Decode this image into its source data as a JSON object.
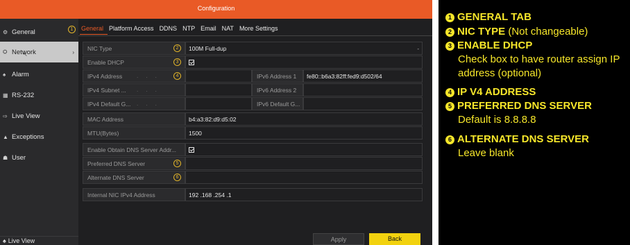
{
  "window": {
    "title": "Configuration"
  },
  "sidebar": {
    "items": [
      {
        "label": "General",
        "icon": "gear-icon",
        "glyph": "⚙"
      },
      {
        "label": "Network",
        "icon": "network-icon",
        "glyph": "⛭",
        "active": true,
        "arrow": "›"
      },
      {
        "label": "Alarm",
        "icon": "alarm-icon",
        "glyph": "♠"
      },
      {
        "label": "RS-232",
        "icon": "rs232-icon",
        "glyph": "▦"
      },
      {
        "label": "Live View",
        "icon": "live-view-icon",
        "glyph": "⇨"
      },
      {
        "label": "Exceptions",
        "icon": "warning-icon",
        "glyph": "▲"
      },
      {
        "label": "User",
        "icon": "user-icon",
        "glyph": "☗"
      }
    ],
    "bottom": {
      "label": "Live View",
      "glyph": "♠"
    }
  },
  "tabs": [
    {
      "label": "General",
      "active": true
    },
    {
      "label": "Platform Access"
    },
    {
      "label": "DDNS"
    },
    {
      "label": "NTP"
    },
    {
      "label": "Email"
    },
    {
      "label": "NAT"
    },
    {
      "label": "More Settings"
    }
  ],
  "markers": [
    "1",
    "2",
    "3",
    "4",
    "5",
    "6"
  ],
  "form": {
    "nic_type": {
      "label": "NIC Type",
      "value": "100M Full-dup"
    },
    "enable_dhcp": {
      "label": "Enable DHCP",
      "checked": true
    },
    "ipv4_address": {
      "label": "IPv4 Address"
    },
    "ipv4_subnet": {
      "label": "IPv4 Subnet ..."
    },
    "ipv4_gateway": {
      "label": "IPv4 Default G..."
    },
    "ipv6_address_1": {
      "label": "IPv6 Address 1",
      "value": "fe80::b6a3:82ff:fed9:d502/64"
    },
    "ipv6_address_2": {
      "label": "IPv6 Address 2"
    },
    "ipv6_gateway": {
      "label": "IPv6 Default G..."
    },
    "mac_address": {
      "label": "MAC Address",
      "value": "b4:a3:82:d9:d5:02"
    },
    "mtu": {
      "label": "MTU(Bytes)",
      "value": "1500"
    },
    "obtain_dns": {
      "label": "Enable Obtain DNS Server Addr...",
      "checked": true
    },
    "preferred_dns": {
      "label": "Preferred DNS Server"
    },
    "alternate_dns": {
      "label": "Alternate DNS Server"
    },
    "internal_nic": {
      "label": "Internal NIC IPv4 Address",
      "value": "192 .168 .254 .1"
    }
  },
  "buttons": {
    "apply": "Apply",
    "back": "Back"
  },
  "annotations": [
    {
      "num": "1",
      "head": "GENERAL TAB",
      "note": ""
    },
    {
      "num": "2",
      "head": "NIC TYPE",
      "note": " (Not changeable)"
    },
    {
      "num": "3",
      "head": "ENABLE DHCP",
      "note": ""
    },
    {
      "num": "4",
      "head": "IP V4 ADDRESS",
      "note": ""
    },
    {
      "num": "5",
      "head": "PREFERRED DNS SERVER",
      "note": ""
    },
    {
      "num": "6",
      "head": "ALTERNATE DNS SERVER",
      "note": ""
    }
  ],
  "annotation_notes": {
    "dhcp_line1": "Check box to have router assign IP",
    "dhcp_line2": "address (optional)",
    "dns_default": "Default is 8.8.8.8",
    "alt_blank": "Leave blank"
  },
  "colors": {
    "titlebar": "#e95a26",
    "accent": "#e95a26",
    "back_button": "#f2d20f",
    "annotation_text": "#f6e62a"
  }
}
